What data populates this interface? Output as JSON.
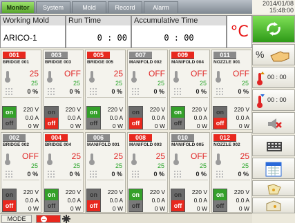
{
  "tabs": [
    "Monitor",
    "System",
    "Mold",
    "Record",
    "Alarm"
  ],
  "datetime": {
    "date": "2014/01/08",
    "time": "15:48:00"
  },
  "header": {
    "mold_label": "Working Mold",
    "mold_value": "ARICO-1",
    "run_label": "Run Time",
    "run_value": "0 : 00",
    "accum_label": "Accumulative Time",
    "accum_value": "0 : 00",
    "unit": "°C"
  },
  "zones": [
    {
      "id": "001",
      "name": "BRIDGE 001",
      "pv": "25",
      "sv": "25",
      "pct": "0 %",
      "on": true,
      "volt": "220 V",
      "amp": "0.0 A",
      "watt": "0 W",
      "alarm": true
    },
    {
      "id": "003",
      "name": "BRIDGE 003",
      "pv": "OFF",
      "sv": "25",
      "pct": "0 %",
      "on": false,
      "volt": "220 V",
      "amp": "0.0 A",
      "watt": "0 W",
      "alarm": false
    },
    {
      "id": "005",
      "name": "BRIDGE 005",
      "pv": "25",
      "sv": "25",
      "pct": "0 %",
      "on": true,
      "volt": "220 V",
      "amp": "0.0 A",
      "watt": "0 W",
      "alarm": true
    },
    {
      "id": "007",
      "name": "MANIFOLD 002",
      "pv": "OFF",
      "sv": "25",
      "pct": "0 %",
      "on": false,
      "volt": "220 V",
      "amp": "0.0 A",
      "watt": "0 W",
      "alarm": false
    },
    {
      "id": "009",
      "name": "MANIFOLD 004",
      "pv": "OFF",
      "sv": "25",
      "pct": "0 %",
      "on": true,
      "volt": "220 V",
      "amp": "0.0 A",
      "watt": "0 W",
      "alarm": true
    },
    {
      "id": "011",
      "name": "NOZZLE 001",
      "pv": "OFF",
      "sv": "25",
      "pct": "0 %",
      "on": false,
      "volt": "220 V",
      "amp": "0.0 A",
      "watt": "0 W",
      "alarm": false
    },
    {
      "id": "002",
      "name": "BRIDGE 002",
      "pv": "OFF",
      "sv": "25",
      "pct": "0 %",
      "on": false,
      "volt": "220 V",
      "amp": "0.0 A",
      "watt": "0 W",
      "alarm": false
    },
    {
      "id": "004",
      "name": "BRIDGE 004",
      "pv": "25",
      "sv": "25",
      "pct": "0 %",
      "on": true,
      "volt": "220 V",
      "amp": "0.0 A",
      "watt": "0 W",
      "alarm": true
    },
    {
      "id": "006",
      "name": "MANIFOLD 001",
      "pv": "25",
      "sv": "25",
      "pct": "0 %",
      "on": false,
      "volt": "220 V",
      "amp": "0.0 A",
      "watt": "0 W",
      "alarm": false
    },
    {
      "id": "008",
      "name": "MANIFOLD 003",
      "pv": "25",
      "sv": "25",
      "pct": "0 %",
      "on": true,
      "volt": "220 V",
      "amp": "0.0 A",
      "watt": "0 W",
      "alarm": true
    },
    {
      "id": "010",
      "name": "MANIFOLD 005",
      "pv": "OFF",
      "sv": "25",
      "pct": "0 %",
      "on": false,
      "volt": "220 V",
      "amp": "0.0 A",
      "watt": "0 W",
      "alarm": false
    },
    {
      "id": "012",
      "name": "NOZZLE 002",
      "pv": "25",
      "sv": "25",
      "pct": "0 %",
      "on": true,
      "volt": "220 V",
      "amp": "0.0 A",
      "watt": "0 W",
      "alarm": true
    }
  ],
  "switch_labels": {
    "on": "on",
    "off": "off"
  },
  "sidebar": {
    "percent_label": "%",
    "timer1": "00 : 00",
    "timer2": "00 : 00"
  },
  "bottom": {
    "mode_label": "MODE"
  },
  "colors": {
    "accent_green": "#5aa52e",
    "alarm_red": "#e8281e",
    "pv_red": "#e02525",
    "sv_green": "#2aa52a"
  }
}
